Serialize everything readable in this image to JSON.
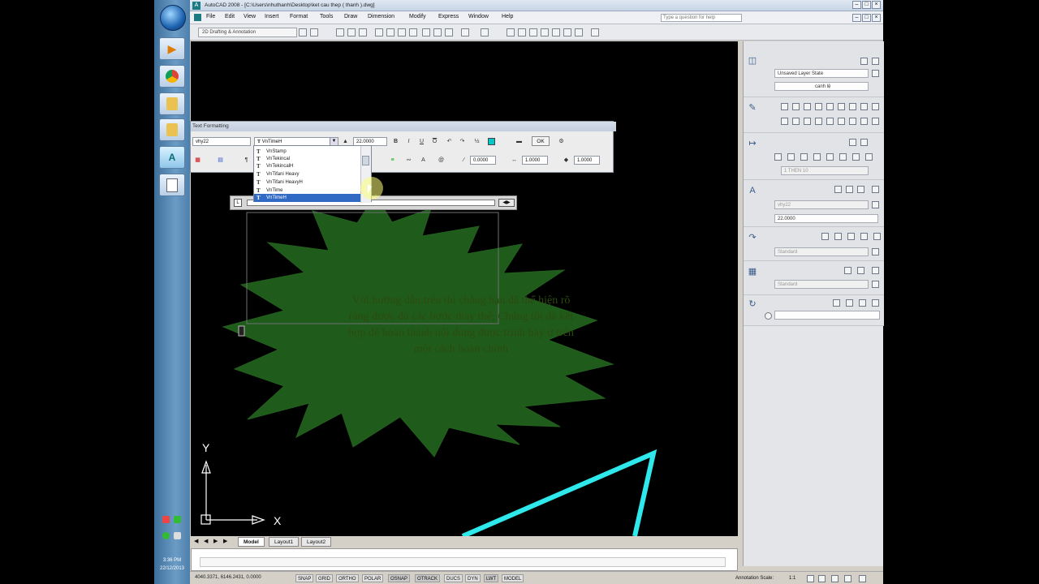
{
  "taskbar": {
    "clock_time": "3:36 PM",
    "clock_date": "22/12/2013"
  },
  "window": {
    "title": "AutoCAD 2008 - [C:\\Users\\nhuthanh\\Desktop\\ket cau thep ( thanh ).dwg]"
  },
  "menu": {
    "items": [
      "File",
      "Edit",
      "View",
      "Insert",
      "Format",
      "Tools",
      "Draw",
      "Dimension",
      "Modify",
      "Express",
      "Window",
      "Help"
    ],
    "help_placeholder": "Type a question for help"
  },
  "toolbar": {
    "workspace": "2D Drafting & Annotation"
  },
  "text_formatting": {
    "title": "Text Formatting",
    "style": "vhy22",
    "font": "VnTimeH",
    "height": "22.0000",
    "ok_label": "OK",
    "oblique": "0.0000",
    "tracking": "1.0000",
    "width": "1.0000",
    "font_list": [
      "VnStamp",
      "VnTekincal",
      "VnTekincalH",
      "VnTifani Heavy",
      "VnTifani HeavyH",
      "VnTime",
      "VnTimeH"
    ],
    "selected_font": "VnTimeH"
  },
  "drawing": {
    "burst_text": "Với hướng dẫn trên thì chẳng hạn đã thể hiện rõ ràng được đủ các bước thay thế; Chúng tôi đã kết hợp để hoàn thành nội dung được trình bày ở trên một cách hoàn chỉnh",
    "ucs_x": "X",
    "ucs_y": "Y",
    "colors": {
      "burst": "#1f5c1c",
      "triangle": "#2ee8ec",
      "burst_text": "#2d4a10"
    }
  },
  "layout_tabs": [
    "Model",
    "Layout1",
    "Layout2"
  ],
  "right_panel": {
    "layer_state": "Unsaved Layer State",
    "layer_name": "canh lệ",
    "dim_style": "1 THEN 10",
    "text_style": "vhy22",
    "text_height": "22.0000",
    "table_style": "Standard",
    "multileader_style": "Standard"
  },
  "status": {
    "coords": "4040.3371, 6146.2431, 0.0000",
    "toggles": [
      "SNAP",
      "GRID",
      "ORTHO",
      "POLAR",
      "OSNAP",
      "OTRACK",
      "DUCS",
      "DYN",
      "LWT",
      "MODEL"
    ],
    "annotation_scale_label": "Annotation Scale:",
    "annotation_scale": "1:1"
  }
}
